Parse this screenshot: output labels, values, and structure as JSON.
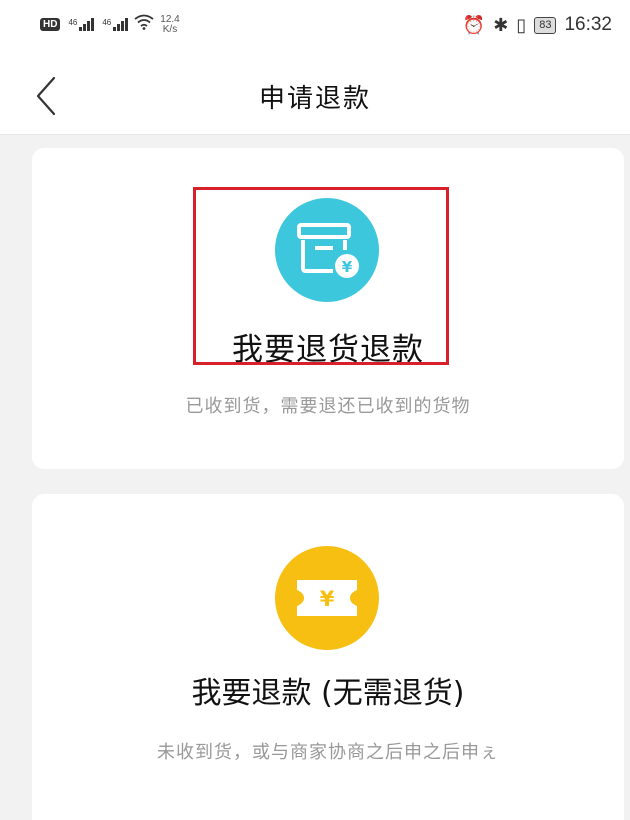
{
  "status_bar": {
    "hd": "HD",
    "network_type_1": "46",
    "network_type_2": "46",
    "speed_value": "12.4",
    "speed_unit": "K/s",
    "battery": "83",
    "time": "16:32"
  },
  "header": {
    "title": "申请退款"
  },
  "options": [
    {
      "label": "我要退货退款",
      "description": "已收到货，需要退还已收到的货物",
      "icon": "box-yen-icon",
      "color": "#3dc7dc"
    },
    {
      "label": "我要退款 (无需退货)",
      "description": "未收到货，或与商家协商之后申之后申ぇ",
      "icon": "yen-ticket-icon",
      "color": "#f6bf12"
    }
  ]
}
